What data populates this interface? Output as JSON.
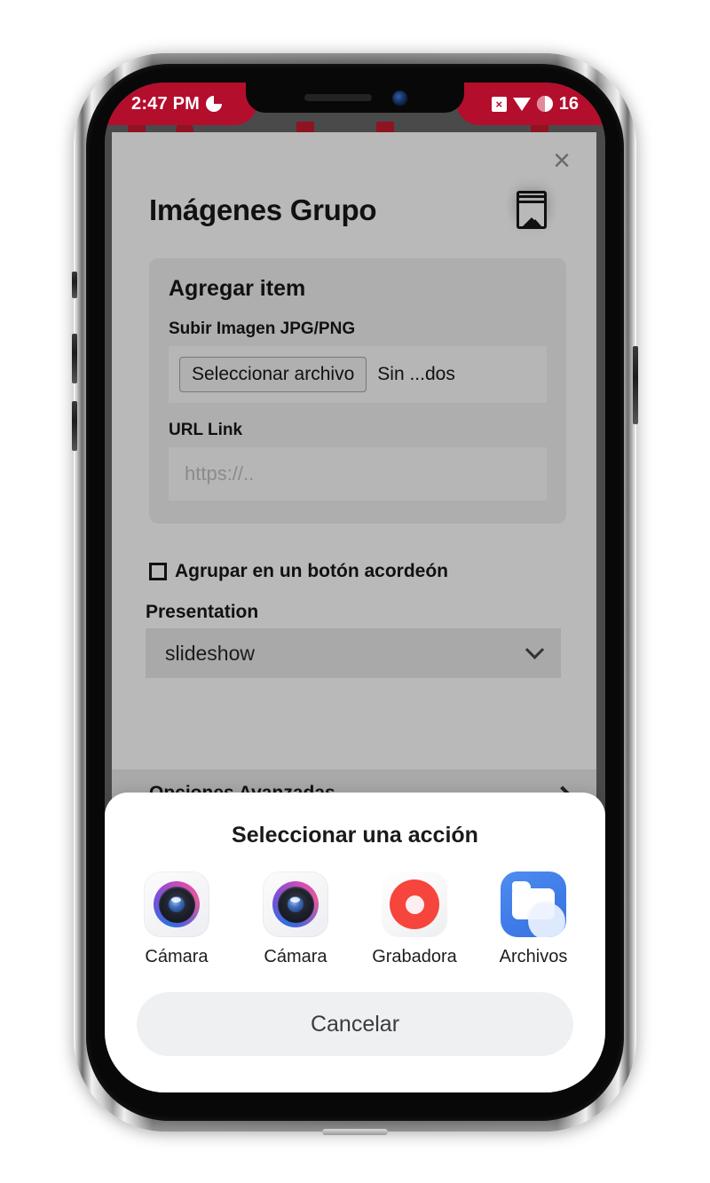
{
  "status_bar": {
    "time": "2:47 PM",
    "alarm_icon": "alarm-clock-icon",
    "sqx_icon": "close-box-icon",
    "download_icon": "download-triangle-icon",
    "battery_icon": "battery-pie-icon",
    "battery_level": "16",
    "accent_color": "#b40e2d"
  },
  "modal": {
    "close_label": "×",
    "title": "Imágenes Grupo",
    "title_icon": "stacked-images-icon",
    "card": {
      "heading": "Agregar item",
      "upload_label": "Subir Imagen JPG/PNG",
      "file_button": "Seleccionar archivo",
      "file_status": "Sin ...dos",
      "url_label": "URL Link",
      "url_value": "",
      "url_placeholder": "https://.."
    },
    "checkbox": {
      "label": "Agrupar en un botón acordeón",
      "checked": false
    },
    "presentation": {
      "label": "Presentation",
      "value": "slideshow",
      "options": [
        "slideshow"
      ]
    },
    "advanced": {
      "label": "Opciones Avanzadas",
      "chevron": "chevron-right-icon"
    }
  },
  "action_sheet": {
    "title": "Seleccionar una acción",
    "apps": [
      {
        "label": "Cámara",
        "icon": "camera-app-icon"
      },
      {
        "label": "Cámara",
        "icon": "camera-app-icon"
      },
      {
        "label": "Grabadora",
        "icon": "voice-recorder-app-icon"
      },
      {
        "label": "Archivos",
        "icon": "files-app-icon"
      }
    ],
    "cancel_label": "Cancelar"
  },
  "device": {
    "notch_speaker": "speaker-grille",
    "notch_camera": "front-camera"
  }
}
